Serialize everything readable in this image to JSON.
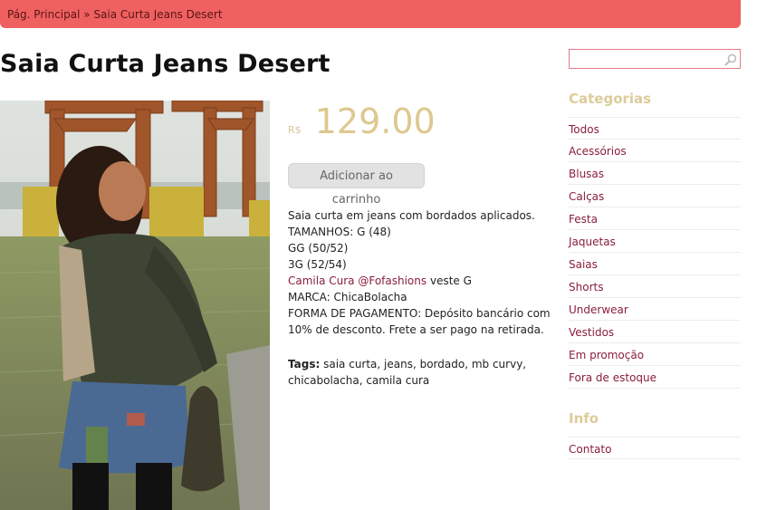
{
  "breadcrumb": {
    "home": "Pág. Principal",
    "separator": "»",
    "current": "Saia Curta Jeans Desert"
  },
  "product": {
    "title": "Saia Curta Jeans Desert",
    "currency": "R$",
    "price": "129.00",
    "add_to_cart": "Adicionar ao carrinho",
    "description": {
      "line1": "Saia curta em jeans com bordados aplicados.",
      "line2": "TAMANHOS: G (48)",
      "line3": "GG (50/52)",
      "line4": "3G (52/54)",
      "model_link": "Camila Cura @Fofashions",
      "model_suffix": "veste G",
      "brand": "MARCA: ChicaBolacha",
      "payment": "FORMA DE PAGAMENTO: Depósito bancário com 10% de desconto. Frete a ser pago na retirada."
    },
    "tags_label": "Tags:",
    "tags": "saia curta, jeans, bordado, mb curvy, chicabolacha, camila cura"
  },
  "search": {
    "value": "",
    "placeholder": ""
  },
  "sidebar": {
    "categories_title": "Categorias",
    "categories": [
      {
        "label": "Todos"
      },
      {
        "label": "Acessórios"
      },
      {
        "label": "Blusas"
      },
      {
        "label": "Calças"
      },
      {
        "label": "Festa"
      },
      {
        "label": "Jaquetas"
      },
      {
        "label": "Saias"
      },
      {
        "label": "Shorts"
      },
      {
        "label": "Underwear"
      },
      {
        "label": "Vestidos"
      },
      {
        "label": "Em promoção"
      },
      {
        "label": "Fora de estoque"
      }
    ],
    "info_title": "Info",
    "info": [
      {
        "label": "Contato"
      }
    ]
  },
  "colors": {
    "breadcrumb_bar": "#ef6161",
    "price": "#ddc890",
    "link": "#8a1f3a",
    "sidebar_heading": "#ddcb9a"
  }
}
